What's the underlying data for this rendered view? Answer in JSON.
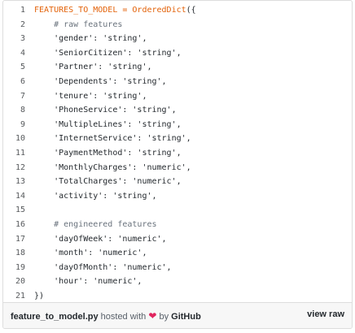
{
  "code": {
    "lines": [
      {
        "num": "1",
        "parts": [
          {
            "t": "FEATURES_TO_MODEL = OrderedDict",
            "c": "k"
          },
          {
            "t": "({",
            "c": ""
          }
        ]
      },
      {
        "num": "2",
        "parts": [
          {
            "t": "    # raw features",
            "c": "c"
          }
        ]
      },
      {
        "num": "3",
        "parts": [
          {
            "t": "    'gender': 'string',",
            "c": ""
          }
        ]
      },
      {
        "num": "4",
        "parts": [
          {
            "t": "    'SeniorCitizen': 'string',",
            "c": ""
          }
        ]
      },
      {
        "num": "5",
        "parts": [
          {
            "t": "    'Partner': 'string',",
            "c": ""
          }
        ]
      },
      {
        "num": "6",
        "parts": [
          {
            "t": "    'Dependents': 'string',",
            "c": ""
          }
        ]
      },
      {
        "num": "7",
        "parts": [
          {
            "t": "    'tenure': 'string',",
            "c": ""
          }
        ]
      },
      {
        "num": "8",
        "parts": [
          {
            "t": "    'PhoneService': 'string',",
            "c": ""
          }
        ]
      },
      {
        "num": "9",
        "parts": [
          {
            "t": "    'MultipleLines': 'string',",
            "c": ""
          }
        ]
      },
      {
        "num": "10",
        "parts": [
          {
            "t": "    'InternetService': 'string',",
            "c": ""
          }
        ]
      },
      {
        "num": "11",
        "parts": [
          {
            "t": "    'PaymentMethod': 'string',",
            "c": ""
          }
        ]
      },
      {
        "num": "12",
        "parts": [
          {
            "t": "    'MonthlyCharges': 'numeric',",
            "c": ""
          }
        ]
      },
      {
        "num": "13",
        "parts": [
          {
            "t": "    'TotalCharges': 'numeric',",
            "c": ""
          }
        ]
      },
      {
        "num": "14",
        "parts": [
          {
            "t": "    'activity': 'string',",
            "c": ""
          }
        ]
      },
      {
        "num": "15",
        "parts": [
          {
            "t": "",
            "c": ""
          }
        ]
      },
      {
        "num": "16",
        "parts": [
          {
            "t": "    # engineered features",
            "c": "c"
          }
        ]
      },
      {
        "num": "17",
        "parts": [
          {
            "t": "    'dayOfWeek': 'numeric',",
            "c": ""
          }
        ]
      },
      {
        "num": "18",
        "parts": [
          {
            "t": "    'month': 'numeric',",
            "c": ""
          }
        ]
      },
      {
        "num": "19",
        "parts": [
          {
            "t": "    'dayOfMonth': 'numeric',",
            "c": ""
          }
        ]
      },
      {
        "num": "20",
        "parts": [
          {
            "t": "    'hour': 'numeric',",
            "c": ""
          }
        ]
      },
      {
        "num": "21",
        "parts": [
          {
            "t": "})",
            "c": ""
          }
        ]
      }
    ]
  },
  "footer": {
    "filename": "feature_to_model.py",
    "hosted_with": " hosted with ",
    "heart_icon": "heart-icon",
    "by": " by ",
    "host": "GitHub",
    "view_raw": "view raw"
  },
  "colors": {
    "keyword": "#e36209",
    "comment": "#6a737d",
    "heart": "#e0245e"
  }
}
